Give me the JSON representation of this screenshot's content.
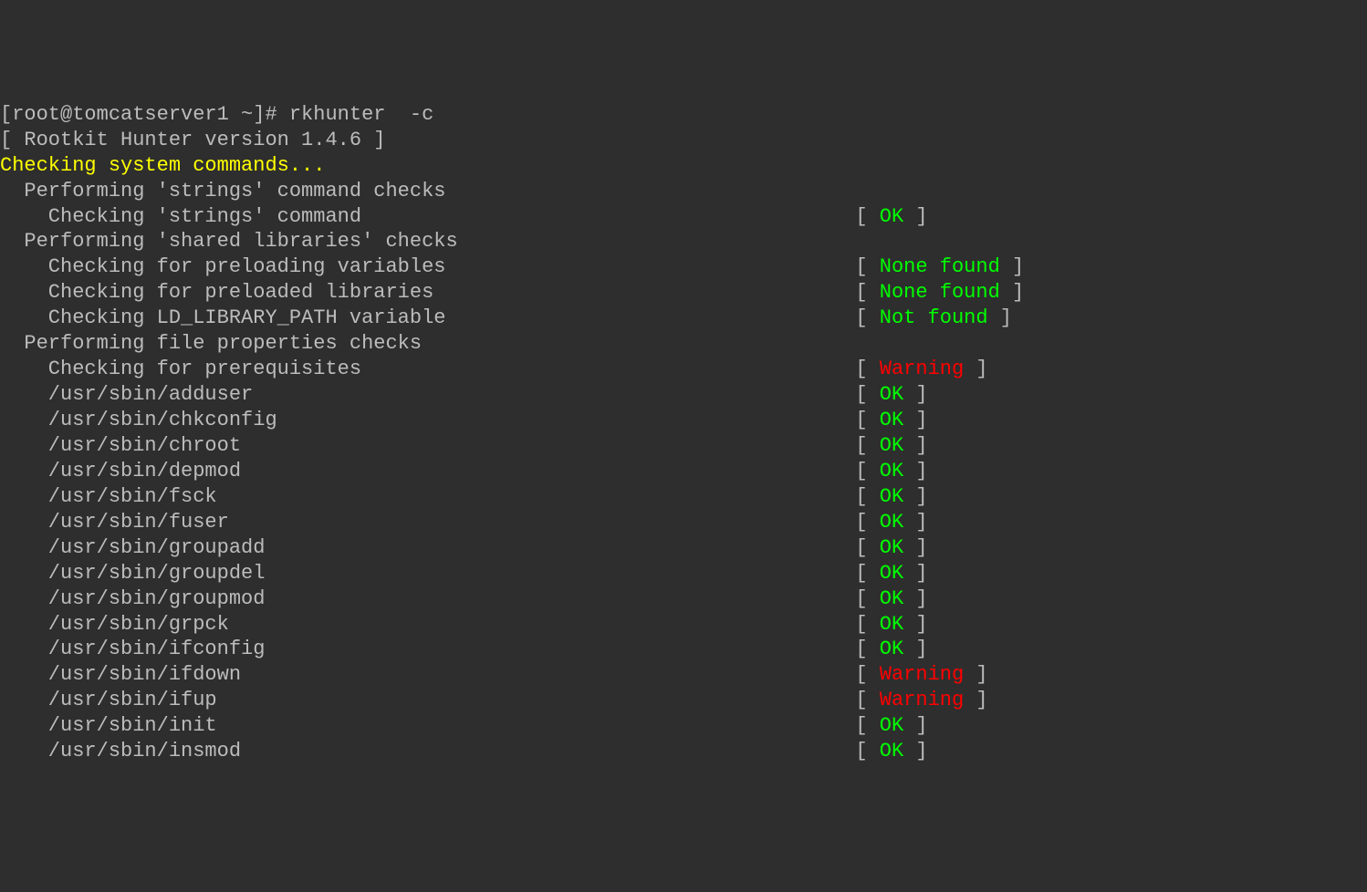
{
  "prompt": "[root@tomcatserver1 ~]# rkhunter  -c",
  "version_line": "[ Rootkit Hunter version 1.4.6 ]",
  "header": "Checking system commands...",
  "sections": [
    {
      "title": "  Performing 'strings' command checks",
      "checks": [
        {
          "label": "    Checking 'strings' command",
          "status": "OK",
          "color": "green"
        }
      ]
    },
    {
      "title": "  Performing 'shared libraries' checks",
      "checks": [
        {
          "label": "    Checking for preloading variables",
          "status": "None found",
          "color": "green"
        },
        {
          "label": "    Checking for preloaded libraries",
          "status": "None found",
          "color": "green"
        },
        {
          "label": "    Checking LD_LIBRARY_PATH variable",
          "status": "Not found",
          "color": "green"
        }
      ]
    },
    {
      "title": "  Performing file properties checks",
      "checks": [
        {
          "label": "    Checking for prerequisites",
          "status": "Warning",
          "color": "red"
        },
        {
          "label": "    /usr/sbin/adduser",
          "status": "OK",
          "color": "green"
        },
        {
          "label": "    /usr/sbin/chkconfig",
          "status": "OK",
          "color": "green"
        },
        {
          "label": "    /usr/sbin/chroot",
          "status": "OK",
          "color": "green"
        },
        {
          "label": "    /usr/sbin/depmod",
          "status": "OK",
          "color": "green"
        },
        {
          "label": "    /usr/sbin/fsck",
          "status": "OK",
          "color": "green"
        },
        {
          "label": "    /usr/sbin/fuser",
          "status": "OK",
          "color": "green"
        },
        {
          "label": "    /usr/sbin/groupadd",
          "status": "OK",
          "color": "green"
        },
        {
          "label": "    /usr/sbin/groupdel",
          "status": "OK",
          "color": "green"
        },
        {
          "label": "    /usr/sbin/groupmod",
          "status": "OK",
          "color": "green"
        },
        {
          "label": "    /usr/sbin/grpck",
          "status": "OK",
          "color": "green"
        },
        {
          "label": "    /usr/sbin/ifconfig",
          "status": "OK",
          "color": "green"
        },
        {
          "label": "    /usr/sbin/ifdown",
          "status": "Warning",
          "color": "red"
        },
        {
          "label": "    /usr/sbin/ifup",
          "status": "Warning",
          "color": "red"
        },
        {
          "label": "    /usr/sbin/init",
          "status": "OK",
          "color": "green"
        },
        {
          "label": "    /usr/sbin/insmod",
          "status": "OK",
          "color": "green"
        }
      ]
    }
  ],
  "brackets": {
    "open": "[ ",
    "close": " ]"
  }
}
